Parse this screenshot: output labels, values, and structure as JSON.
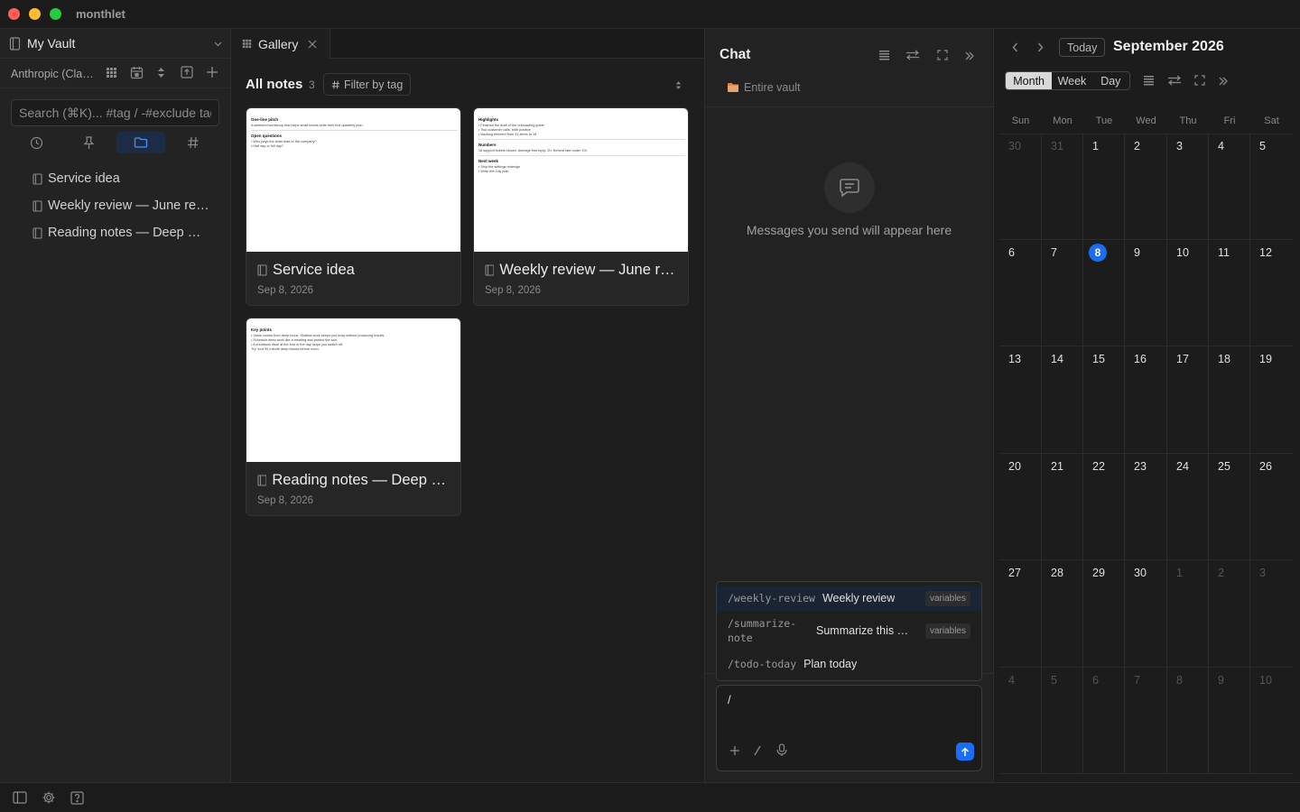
{
  "window": {
    "app_title": "monthlet"
  },
  "sidebar": {
    "vault_name": "My Vault",
    "account_name": "Anthropic (Claude)",
    "search_placeholder": "Search (⌘K)... #tag / -#exclude tag",
    "tabs": [
      "recent",
      "pinned",
      "folders",
      "tags"
    ],
    "active_tab": "folders",
    "files": [
      {
        "label": "Service idea"
      },
      {
        "label": "Weekly review — June recap"
      },
      {
        "label": "Reading notes — Deep Work"
      }
    ]
  },
  "gallery": {
    "tab_label": "Gallery",
    "title": "All notes",
    "count": "3",
    "filter_label": "Filter by tag",
    "cards": [
      {
        "title": "Service idea",
        "date": "Sep 8, 2026",
        "preview": [
          {
            "k": "h",
            "t": "One-line pitch"
          },
          {
            "k": "p",
            "t": "A weekend workshop that helps small teams write their first quarterly plan."
          },
          {
            "k": "l"
          },
          {
            "k": "h",
            "t": "Open questions"
          },
          {
            "k": "p",
            "t": "• Who pays the team lead or the company?"
          },
          {
            "k": "p",
            "t": "• Half day or full day?"
          }
        ]
      },
      {
        "title": "Weekly review — June recap",
        "date": "Sep 8, 2026",
        "preview": [
          {
            "k": "h",
            "t": "Highlights"
          },
          {
            "k": "p",
            "t": "• Finished the draft of the onboarding guide"
          },
          {
            "k": "p",
            "t": "• Two customer calls, both positive"
          },
          {
            "k": "p",
            "t": "• Backlog trimmed from 41 items to 18"
          },
          {
            "k": "l"
          },
          {
            "k": "h",
            "t": "Numbers"
          },
          {
            "k": "p",
            "t": "18 support tickets closed. Average first reply: 2h. Refund rate under 1%."
          },
          {
            "k": "l"
          },
          {
            "k": "h",
            "t": "Next week"
          },
          {
            "k": "p",
            "t": "• Ship the settings redesign"
          },
          {
            "k": "p",
            "t": "• Write the July plan"
          }
        ]
      },
      {
        "title": "Reading notes — Deep Work",
        "date": "Sep 8, 2026",
        "preview": [
          {
            "k": "h",
            "t": "Key points"
          },
          {
            "k": "p",
            "t": "• Value comes from deep focus. Shallow work keeps you busy without producing results."
          },
          {
            "k": "p",
            "t": "• Schedule deep work like a meeting and protect the slot."
          },
          {
            "k": "p",
            "t": "• A shutdown ritual at the end of the day helps you switch off."
          },
          {
            "k": "p",
            "t": "Try: four 90-minute deep blocks before noon."
          }
        ]
      }
    ]
  },
  "chat": {
    "title": "Chat",
    "scope": "Entire vault",
    "empty_message": "Messages you send will appear here",
    "commands": [
      {
        "trigger": "/weekly-review",
        "desc": "Weekly review",
        "badge": "variables"
      },
      {
        "trigger": "/summarize-note",
        "desc": "Summarize this note",
        "badge": "variables"
      },
      {
        "trigger": "/todo-today",
        "desc": "Plan today",
        "badge": ""
      }
    ],
    "input_value": "/"
  },
  "calendar": {
    "today_label": "Today",
    "title": "September 2026",
    "views": [
      "Month",
      "Week",
      "Day"
    ],
    "active_view": "Month",
    "weekdays": [
      "Sun",
      "Mon",
      "Tue",
      "Wed",
      "Thu",
      "Fri",
      "Sat"
    ],
    "today": 8,
    "weeks": [
      [
        [
          "30",
          1
        ],
        [
          "31",
          1
        ],
        [
          "1",
          0
        ],
        [
          "2",
          0
        ],
        [
          "3",
          0
        ],
        [
          "4",
          0
        ],
        [
          "5",
          0
        ]
      ],
      [
        [
          "6",
          0
        ],
        [
          "7",
          0
        ],
        [
          "8",
          0
        ],
        [
          "9",
          0
        ],
        [
          "10",
          0
        ],
        [
          "11",
          0
        ],
        [
          "12",
          0
        ]
      ],
      [
        [
          "13",
          0
        ],
        [
          "14",
          0
        ],
        [
          "15",
          0
        ],
        [
          "16",
          0
        ],
        [
          "17",
          0
        ],
        [
          "18",
          0
        ],
        [
          "19",
          0
        ]
      ],
      [
        [
          "20",
          0
        ],
        [
          "21",
          0
        ],
        [
          "22",
          0
        ],
        [
          "23",
          0
        ],
        [
          "24",
          0
        ],
        [
          "25",
          0
        ],
        [
          "26",
          0
        ]
      ],
      [
        [
          "27",
          0
        ],
        [
          "28",
          0
        ],
        [
          "29",
          0
        ],
        [
          "30",
          0
        ],
        [
          "1",
          1
        ],
        [
          "2",
          1
        ],
        [
          "3",
          1
        ]
      ],
      [
        [
          "4",
          1
        ],
        [
          "5",
          1
        ],
        [
          "6",
          1
        ],
        [
          "7",
          1
        ],
        [
          "8",
          1
        ],
        [
          "9",
          1
        ],
        [
          "10",
          1
        ]
      ]
    ]
  },
  "colors": {
    "accent": "#1a6ef5",
    "active_tab_bg": "#1d2c45",
    "background": "#1e1e1e"
  }
}
